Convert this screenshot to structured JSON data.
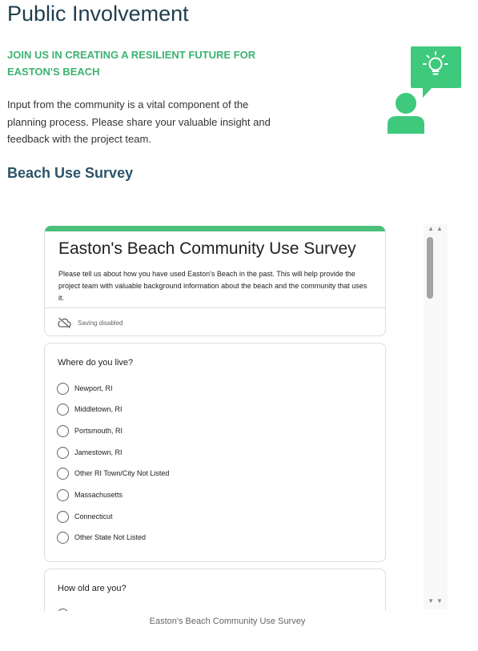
{
  "page": {
    "title": "Public Involvement",
    "subheading": "JOIN US IN CREATING A RESILIENT FUTURE FOR EASTON'S BEACH",
    "intro": "Input from the community is a vital component of the planning process. Please share your valuable insight and feedback with the project team.",
    "section_title": "Beach Use Survey",
    "caption": "Easton's Beach Community Use Survey"
  },
  "illustration": {
    "icons": [
      "person-icon",
      "speech-bubble-icon",
      "lightbulb-icon"
    ],
    "color": "#3ec97c"
  },
  "form": {
    "accent_color": "#4cbf7c",
    "title": "Easton's Beach Community Use Survey",
    "description": "Please tell us about how you have used Easton's Beach in the past. This will help provide the project team with valuable background information about the beach and the community that uses it.",
    "saving_status": "Saving disabled",
    "saving_icon": "cloud-off-icon",
    "questions": [
      {
        "title": "Where do you live?",
        "options": [
          "Newport, RI",
          "Middletown, RI",
          "Portsmouth, RI",
          "Jamestown, RI",
          "Other RI Town/City Not Listed",
          "Massachusetts",
          "Connecticut",
          "Other State Not Listed"
        ]
      },
      {
        "title": "How old are you?",
        "options": []
      }
    ]
  },
  "scrollbar": {
    "up_icon": "scroll-up-arrows-icon",
    "down_icon": "scroll-down-arrows-icon"
  }
}
